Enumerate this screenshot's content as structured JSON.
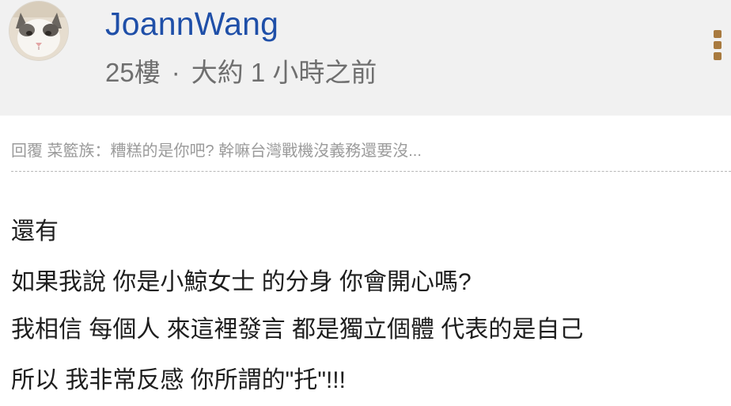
{
  "author": {
    "name": "JoannWang",
    "avatar_icon": "cat-avatar-icon"
  },
  "meta": {
    "floor": "25樓",
    "separator": "·",
    "time": "大約 1 小時之前"
  },
  "more_icon": "vertical-ellipsis-icon",
  "reply_quote": "回覆 菜籃族：糟糕的是你吧? 幹嘛台灣戰機沒義務還要沒...",
  "body": [
    "還有",
    "如果我說 你是小鯨女士 的分身 你會開心嗎?",
    "我相信 每個人 來這裡發言 都是獨立個體 代表的是自己",
    "所以 我非常反感 你所謂的\"托\"!!!"
  ],
  "colors": {
    "header_bg": "#f1f1f1",
    "username": "#1f4fa8",
    "meta_text": "#6f6f6f",
    "more_icon": "#a87a3f",
    "quote_text": "#9b9b9b",
    "body_text": "#1e1e1e"
  }
}
